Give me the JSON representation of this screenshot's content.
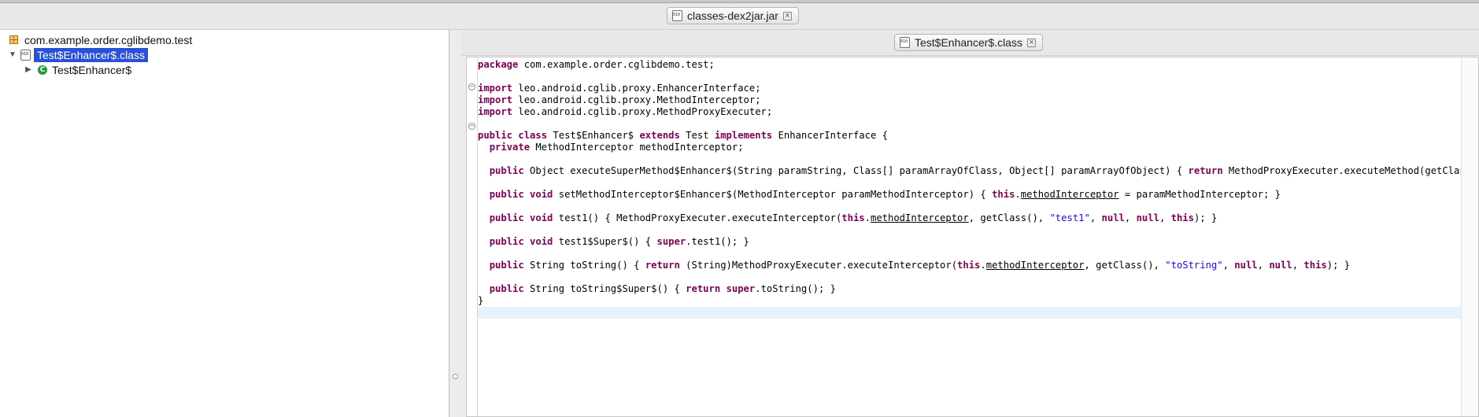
{
  "top_tab": {
    "label": "classes-dex2jar.jar"
  },
  "tree": {
    "package": "com.example.order.cglibdemo.test",
    "class_file": "Test$Enhancer$.class",
    "class_node": "Test$Enhancer$"
  },
  "editor_tab": {
    "label": "Test$Enhancer$.class"
  },
  "colors": {
    "keyword": "#7f0055",
    "string": "#2a00ff",
    "selection": "#2851d8",
    "current_line": "#e8f2fe"
  },
  "code": [
    [
      [
        "t",
        "package"
      ],
      [
        "p",
        " com.example.order.cglibdemo.test;"
      ]
    ],
    [],
    [
      [
        "k",
        "import"
      ],
      [
        "p",
        " leo.android.cglib.proxy.EnhancerInterface;"
      ]
    ],
    [
      [
        "k",
        "import"
      ],
      [
        "p",
        " leo.android.cglib.proxy.MethodInterceptor;"
      ]
    ],
    [
      [
        "k",
        "import"
      ],
      [
        "p",
        " leo.android.cglib.proxy.MethodProxyExecuter;"
      ]
    ],
    [],
    [
      [
        "k",
        "public class"
      ],
      [
        "p",
        " Test$Enhancer$ "
      ],
      [
        "k",
        "extends"
      ],
      [
        "p",
        " Test "
      ],
      [
        "k",
        "implements"
      ],
      [
        "p",
        " EnhancerInterface {"
      ]
    ],
    [
      [
        "p",
        "  "
      ],
      [
        "k",
        "private"
      ],
      [
        "p",
        " MethodInterceptor methodInterceptor;"
      ]
    ],
    [],
    [
      [
        "p",
        "  "
      ],
      [
        "k",
        "public"
      ],
      [
        "p",
        " Object executeSuperMethod$Enhancer$(String paramString, Class[] paramArrayOfClass, Object[] paramArrayOfObject) { "
      ],
      [
        "k",
        "return"
      ],
      [
        "p",
        " MethodProxyExecuter.executeMethod(getClass(), p"
      ]
    ],
    [],
    [
      [
        "p",
        "  "
      ],
      [
        "k",
        "public void"
      ],
      [
        "p",
        " setMethodInterceptor$Enhancer$(MethodInterceptor paramMethodInterceptor) { "
      ],
      [
        "k",
        "this"
      ],
      [
        "p",
        "."
      ],
      [
        "f",
        "methodInterceptor"
      ],
      [
        "p",
        " = paramMethodInterceptor; }"
      ]
    ],
    [],
    [
      [
        "p",
        "  "
      ],
      [
        "k",
        "public void"
      ],
      [
        "p",
        " test1() { MethodProxyExecuter.executeInterceptor("
      ],
      [
        "k",
        "this"
      ],
      [
        "p",
        "."
      ],
      [
        "f",
        "methodInterceptor"
      ],
      [
        "p",
        ", getClass(), "
      ],
      [
        "s",
        "\"test1\""
      ],
      [
        "p",
        ", "
      ],
      [
        "k",
        "null"
      ],
      [
        "p",
        ", "
      ],
      [
        "k",
        "null"
      ],
      [
        "p",
        ", "
      ],
      [
        "k",
        "this"
      ],
      [
        "p",
        "); }"
      ]
    ],
    [],
    [
      [
        "p",
        "  "
      ],
      [
        "k",
        "public void"
      ],
      [
        "p",
        " test1$Super$() { "
      ],
      [
        "k",
        "super"
      ],
      [
        "p",
        ".test1(); }"
      ]
    ],
    [],
    [
      [
        "p",
        "  "
      ],
      [
        "k",
        "public"
      ],
      [
        "p",
        " String toString() { "
      ],
      [
        "k",
        "return"
      ],
      [
        "p",
        " (String)MethodProxyExecuter.executeInterceptor("
      ],
      [
        "k",
        "this"
      ],
      [
        "p",
        "."
      ],
      [
        "f",
        "methodInterceptor"
      ],
      [
        "p",
        ", getClass(), "
      ],
      [
        "s",
        "\"toString\""
      ],
      [
        "p",
        ", "
      ],
      [
        "k",
        "null"
      ],
      [
        "p",
        ", "
      ],
      [
        "k",
        "null"
      ],
      [
        "p",
        ", "
      ],
      [
        "k",
        "this"
      ],
      [
        "p",
        "); }"
      ]
    ],
    [],
    [
      [
        "p",
        "  "
      ],
      [
        "k",
        "public"
      ],
      [
        "p",
        " String toString$Super$() { "
      ],
      [
        "k",
        "return super"
      ],
      [
        "p",
        ".toString(); }"
      ]
    ],
    [
      [
        "p",
        "}"
      ]
    ]
  ]
}
